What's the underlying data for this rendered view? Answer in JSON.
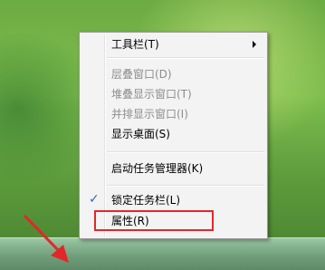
{
  "colors": {
    "highlight_box": "#e3262a",
    "arrow": "#e3262a",
    "checkmark": "#2a6ad1"
  },
  "context_menu": {
    "items": [
      {
        "label": "工具栏(T)",
        "enabled": true,
        "has_submenu": true
      },
      {
        "label": "层叠窗口(D)",
        "enabled": false
      },
      {
        "label": "堆叠显示窗口(T)",
        "enabled": false
      },
      {
        "label": "并排显示窗口(I)",
        "enabled": false
      },
      {
        "label": "显示桌面(S)",
        "enabled": true
      },
      {
        "label": "启动任务管理器(K)",
        "enabled": true
      },
      {
        "label": "锁定任务栏(L)",
        "enabled": true,
        "checked": true
      },
      {
        "label": "属性(R)",
        "enabled": true,
        "annotated": true
      }
    ],
    "check_glyph": "✓",
    "submenu_icon": "chevron-right-icon"
  }
}
